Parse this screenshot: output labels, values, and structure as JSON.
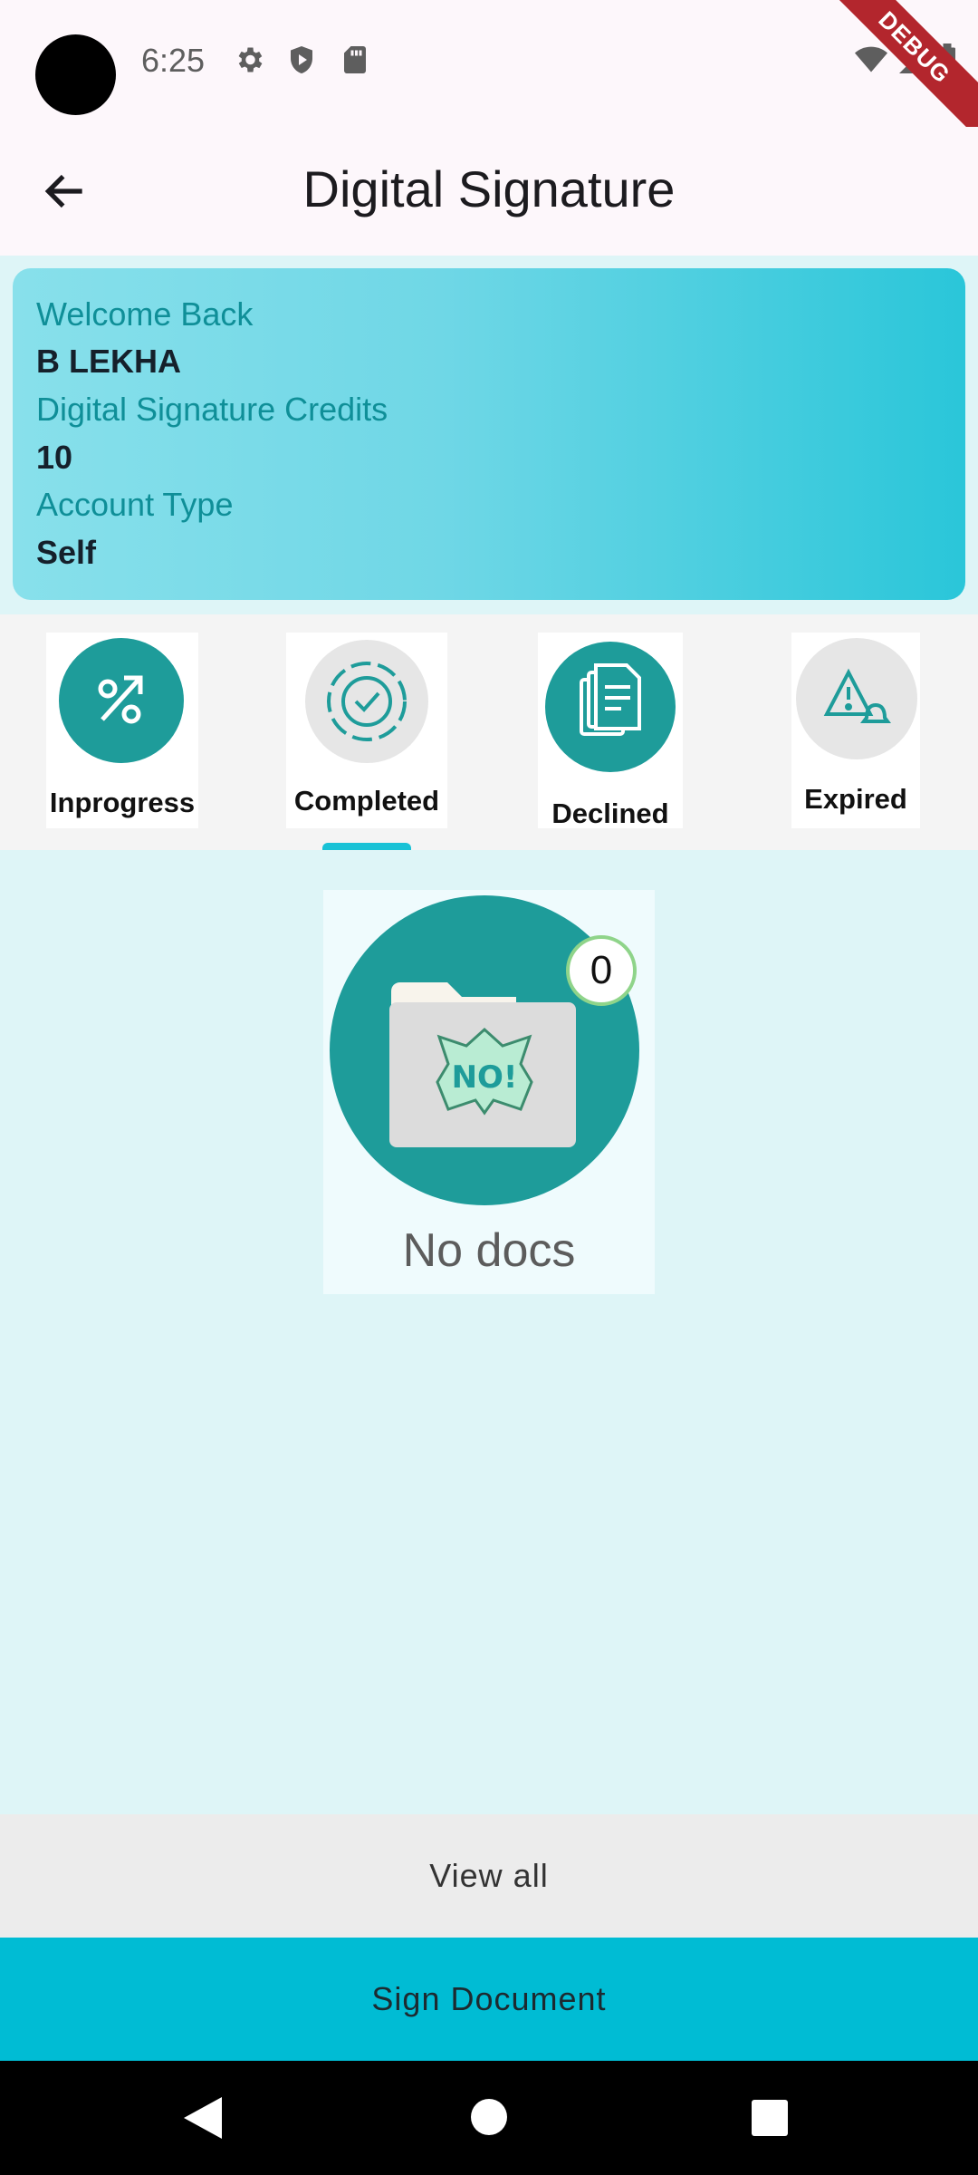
{
  "status_bar": {
    "time": "6:25",
    "icons": [
      "gear-icon",
      "shield-play-icon",
      "sd-card-icon",
      "wifi-icon",
      "signal-icon",
      "battery-icon"
    ],
    "debug_banner": "DEBUG"
  },
  "app_bar": {
    "title": "Digital Signature",
    "back_icon": "arrow-back-icon"
  },
  "account_card": {
    "welcome_label": "Welcome Back",
    "user_name": "B LEKHA",
    "credits_label": "Digital Signature Credits",
    "credits_value": "10",
    "account_type_label": "Account Type",
    "account_type_value": "Self"
  },
  "tabs": [
    {
      "label": "Inprogress",
      "icon": "progress-percent-icon"
    },
    {
      "label": "Completed",
      "icon": "gear-check-icon",
      "selected": true
    },
    {
      "label": "Declined",
      "icon": "documents-icon"
    },
    {
      "label": "Expired",
      "icon": "alert-bell-icon"
    }
  ],
  "empty_state": {
    "count": "0",
    "folder_text": "NO!",
    "message": "No docs"
  },
  "buttons": {
    "view_all": "View all",
    "sign_document": "Sign Document"
  },
  "nav_bar": [
    "back-triangle-icon",
    "home-circle-icon",
    "recents-square-icon"
  ]
}
